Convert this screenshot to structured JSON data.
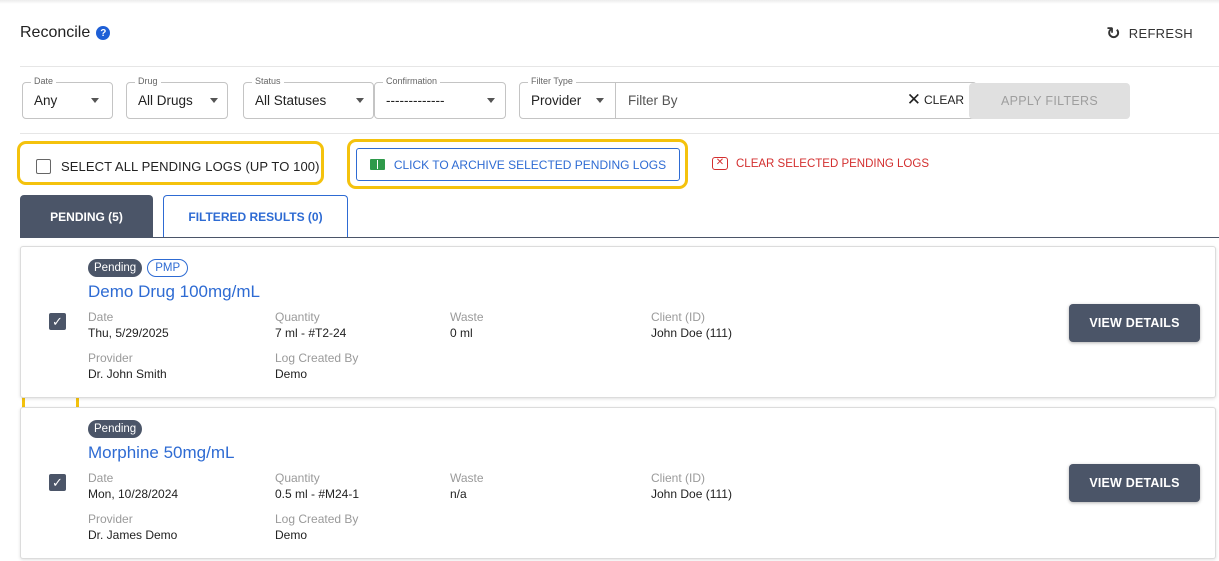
{
  "header": {
    "title": "Reconcile",
    "help_glyph": "?",
    "refresh_label": "REFRESH"
  },
  "filters": {
    "date": {
      "label": "Date",
      "value": "Any"
    },
    "drug": {
      "label": "Drug",
      "value": "All Drugs"
    },
    "status": {
      "label": "Status",
      "value": "All Statuses"
    },
    "confirmation": {
      "label": "Confirmation",
      "value": "-------------"
    },
    "filter_type": {
      "label": "Filter Type",
      "value": "Provider"
    },
    "filter_by_placeholder": "Filter By",
    "clear_label": "CLEAR",
    "apply_label": "APPLY FILTERS"
  },
  "actions": {
    "select_all_label": "SELECT ALL PENDING LOGS (UP TO 100)",
    "archive_label": "CLICK TO ARCHIVE SELECTED PENDING LOGS",
    "clear_selected_label": "CLEAR SELECTED PENDING LOGS"
  },
  "tabs": [
    {
      "label": "PENDING (5)",
      "active": true
    },
    {
      "label": "FILTERED RESULTS (0)",
      "active": false
    }
  ],
  "field_labels": {
    "date": "Date",
    "quantity": "Quantity",
    "waste": "Waste",
    "client": "Client (ID)",
    "provider": "Provider",
    "created_by": "Log Created By"
  },
  "logs": [
    {
      "status": "Pending",
      "tag": "PMP",
      "drug": "Demo Drug 100mg/mL",
      "checked": true,
      "date": "Thu, 5/29/2025",
      "quantity": "7 ml - #T2-24",
      "waste": "0 ml",
      "client": "John Doe (111)",
      "provider": "Dr. John Smith",
      "created_by": "Demo",
      "view_label": "VIEW DETAILS"
    },
    {
      "status": "Pending",
      "tag": "",
      "drug": "Morphine 50mg/mL",
      "checked": true,
      "date": "Mon, 10/28/2024",
      "quantity": "0.5 ml - #M24-1",
      "waste": "n/a",
      "client": "John Doe (111)",
      "provider": "Dr. James Demo",
      "created_by": "Demo",
      "view_label": "VIEW DETAILS"
    }
  ],
  "icons": {
    "help": "help-circle-icon",
    "refresh": "refresh-icon",
    "clear": "close-icon",
    "archive": "book-icon",
    "clear_selected": "x-square-icon",
    "check": "checkmark-icon"
  },
  "colors": {
    "accent_blue": "#2e6bd3",
    "slate": "#4b5568",
    "danger": "#d32f2f",
    "highlight": "#f4c20d",
    "archive_green": "#2e9a4a"
  }
}
